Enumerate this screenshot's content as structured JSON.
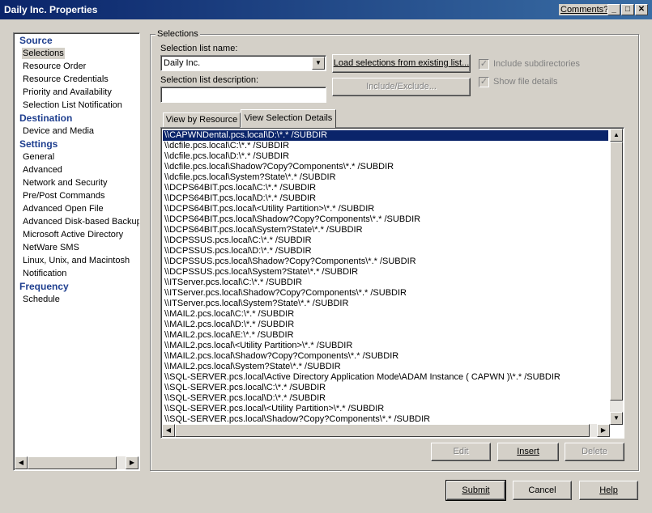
{
  "window": {
    "title": "Daily Inc. Properties",
    "comments_label": "Comments?",
    "minimize": "_",
    "maximize": "□",
    "close": "✕"
  },
  "nav": {
    "sections": [
      {
        "heading": "Source",
        "items": [
          "Selections",
          "Resource Order",
          "Resource Credentials",
          "Priority and Availability",
          "Selection List Notification"
        ]
      },
      {
        "heading": "Destination",
        "items": [
          "Device and Media"
        ]
      },
      {
        "heading": "Settings",
        "items": [
          "General",
          "Advanced",
          "Network and Security",
          "Pre/Post Commands",
          "Advanced Open File",
          "Advanced Disk-based Backup",
          "Microsoft Active Directory",
          "NetWare SMS",
          "Linux, Unix, and Macintosh",
          "Notification"
        ]
      },
      {
        "heading": "Frequency",
        "items": [
          "Schedule"
        ]
      }
    ],
    "selected_item": "Selections"
  },
  "selections": {
    "group_label": "Selections",
    "list_name_label": "Selection list name:",
    "list_name_value": "Daily Inc.",
    "description_label": "Selection list description:",
    "description_value": "",
    "load_button": "Load selections from existing list...",
    "include_exclude_button": "Include/Exclude...",
    "include_subdirectories_label": "Include subdirectories",
    "include_subdirectories_checked": true,
    "show_file_details_label": "Show file details",
    "show_file_details_checked": true,
    "tabs": [
      "View by Resource",
      "View Selection Details"
    ],
    "active_tab": "View Selection Details",
    "rows": [
      "\\\\CAPWNDental.pcs.local\\D:\\*.* /SUBDIR",
      "\\\\dcfile.pcs.local\\C:\\*.* /SUBDIR",
      "\\\\dcfile.pcs.local\\D:\\*.* /SUBDIR",
      "\\\\dcfile.pcs.local\\Shadow?Copy?Components\\*.* /SUBDIR",
      "\\\\dcfile.pcs.local\\System?State\\*.* /SUBDIR",
      "\\\\DCPS64BIT.pcs.local\\C:\\*.* /SUBDIR",
      "\\\\DCPS64BIT.pcs.local\\D:\\*.* /SUBDIR",
      "\\\\DCPS64BIT.pcs.local\\<Utility Partition>\\*.* /SUBDIR",
      "\\\\DCPS64BIT.pcs.local\\Shadow?Copy?Components\\*.* /SUBDIR",
      "\\\\DCPS64BIT.pcs.local\\System?State\\*.* /SUBDIR",
      "\\\\DCPSSUS.pcs.local\\C:\\*.* /SUBDIR",
      "\\\\DCPSSUS.pcs.local\\D:\\*.* /SUBDIR",
      "\\\\DCPSSUS.pcs.local\\Shadow?Copy?Components\\*.* /SUBDIR",
      "\\\\DCPSSUS.pcs.local\\System?State\\*.* /SUBDIR",
      "\\\\ITServer.pcs.local\\C:\\*.* /SUBDIR",
      "\\\\ITServer.pcs.local\\Shadow?Copy?Components\\*.* /SUBDIR",
      "\\\\ITServer.pcs.local\\System?State\\*.* /SUBDIR",
      "\\\\MAIL2.pcs.local\\C:\\*.* /SUBDIR",
      "\\\\MAIL2.pcs.local\\D:\\*.* /SUBDIR",
      "\\\\MAIL2.pcs.local\\E:\\*.* /SUBDIR",
      "\\\\MAIL2.pcs.local\\<Utility Partition>\\*.* /SUBDIR",
      "\\\\MAIL2.pcs.local\\Shadow?Copy?Components\\*.* /SUBDIR",
      "\\\\MAIL2.pcs.local\\System?State\\*.* /SUBDIR",
      "\\\\SQL-SERVER.pcs.local\\Active Directory Application Mode\\ADAM Instance ( CAPWN )\\*.* /SUBDIR",
      "\\\\SQL-SERVER.pcs.local\\C:\\*.* /SUBDIR",
      "\\\\SQL-SERVER.pcs.local\\D:\\*.* /SUBDIR",
      "\\\\SQL-SERVER.pcs.local\\<Utility Partition>\\*.* /SUBDIR",
      "\\\\SQL-SERVER.pcs.local\\Shadow?Copy?Components\\*.* /SUBDIR"
    ],
    "selected_row": 0,
    "edit_button": "Edit",
    "insert_button": "Insert",
    "delete_button": "Delete"
  },
  "footer": {
    "submit_button": "Submit",
    "cancel_button": "Cancel",
    "help_button": "Help"
  },
  "colors": {
    "title_bar": "#0a246a",
    "selection_highlight": "#0a246a",
    "nav_heading": "#1f3f8f",
    "window_face": "#d4d0c8"
  }
}
